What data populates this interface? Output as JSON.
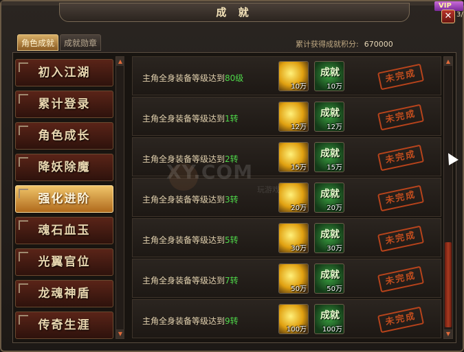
{
  "window": {
    "title": "成 就",
    "close_label": "✕"
  },
  "vip": {
    "badge": "VIP",
    "num": "3/"
  },
  "tabs": [
    {
      "label": "角色成就",
      "active": true
    },
    {
      "label": "成就勋章",
      "active": false
    }
  ],
  "score": {
    "label": "累计获得成就积分:",
    "value": "670000"
  },
  "categories": [
    {
      "label": "初入江湖"
    },
    {
      "label": "累计登录"
    },
    {
      "label": "角色成长"
    },
    {
      "label": "降妖除魔"
    },
    {
      "label": "强化进阶",
      "active": true
    },
    {
      "label": "魂石血玉"
    },
    {
      "label": "光翼官位"
    },
    {
      "label": "龙魂神盾"
    },
    {
      "label": "传奇生涯"
    }
  ],
  "rows": [
    {
      "prefix": "主角全身装备等级达到",
      "level": "80级",
      "gold": "10万",
      "ach_label": "成就",
      "ach": "10万",
      "status": "未完成"
    },
    {
      "prefix": "主角全身装备等级达到",
      "level": "1转",
      "gold": "12万",
      "ach_label": "成就",
      "ach": "12万",
      "status": "未完成"
    },
    {
      "prefix": "主角全身装备等级达到",
      "level": "2转",
      "gold": "15万",
      "ach_label": "成就",
      "ach": "15万",
      "status": "未完成"
    },
    {
      "prefix": "主角全身装备等级达到",
      "level": "3转",
      "gold": "20万",
      "ach_label": "成就",
      "ach": "20万",
      "status": "未完成"
    },
    {
      "prefix": "主角全身装备等级达到",
      "level": "5转",
      "gold": "30万",
      "ach_label": "成就",
      "ach": "30万",
      "status": "未完成"
    },
    {
      "prefix": "主角全身装备等级达到",
      "level": "7转",
      "gold": "50万",
      "ach_label": "成就",
      "ach": "50万",
      "status": "未完成"
    },
    {
      "prefix": "主角全身装备等级达到",
      "level": "9转",
      "gold": "100万",
      "ach_label": "成就",
      "ach": "100万",
      "status": "未完成"
    }
  ],
  "watermark": {
    "main": "XY.COM",
    "sub": "玩游戏"
  },
  "icons": {
    "gold": "gold-coins-icon",
    "achievement": "achievement-badge-icon",
    "close": "close-icon"
  }
}
